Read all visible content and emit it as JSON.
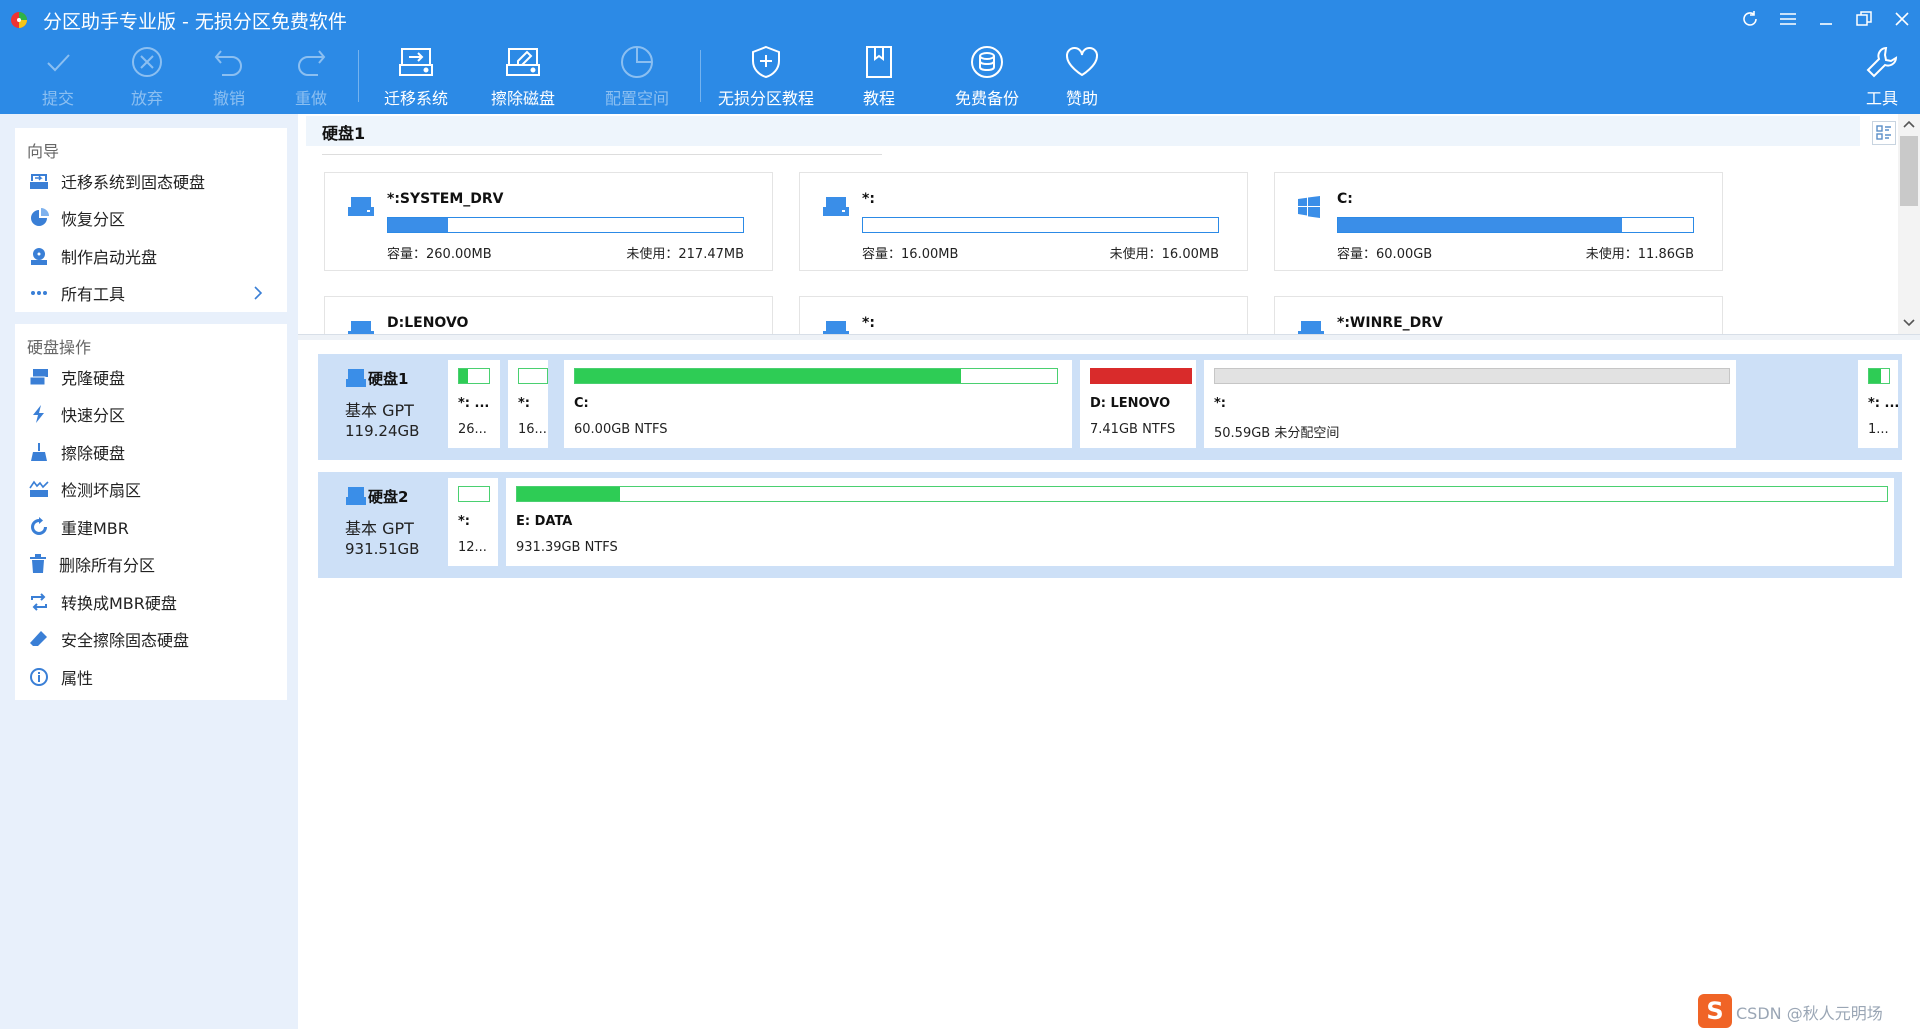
{
  "window": {
    "title": "分区助手专业版 - 无损分区免费软件"
  },
  "toolbar": {
    "commit": "提交",
    "discard": "放弃",
    "undo": "撤销",
    "redo": "重做",
    "migrate_os": "迁移系统",
    "wipe_disk": "擦除磁盘",
    "allocate_space": "配置空间",
    "tutorial_lossless": "无损分区教程",
    "tutorial": "教程",
    "free_backup": "免费备份",
    "donate": "赞助",
    "tools": "工具"
  },
  "sidebar": {
    "wizard_header": "向导",
    "wizard_items": [
      "迁移系统到固态硬盘",
      "恢复分区",
      "制作启动光盘",
      "所有工具"
    ],
    "disk_ops_header": "硬盘操作",
    "disk_ops_items": [
      "克隆硬盘",
      "快速分区",
      "擦除硬盘",
      "检测坏扇区",
      "重建MBR",
      "删除所有分区",
      "转换成MBR硬盘",
      "安全擦除固态硬盘",
      "属性"
    ]
  },
  "card_view": {
    "disk_tab": "硬盘1",
    "cap_label": "容量：",
    "free_label": "未使用：",
    "cards": [
      {
        "name": "*:SYSTEM_DRV",
        "capacity": "260.00MB",
        "free": "217.47MB",
        "used_fraction": 0.17,
        "icon": "drive-icon"
      },
      {
        "name": "*:",
        "capacity": "16.00MB",
        "free": "16.00MB",
        "used_fraction": 0.0,
        "icon": "drive-icon"
      },
      {
        "name": "C:",
        "capacity": "60.00GB",
        "free": "11.86GB",
        "used_fraction": 0.8,
        "icon": "windows-icon"
      },
      {
        "name": "D:LENOVO",
        "icon": "drive-icon"
      },
      {
        "name": "*:",
        "icon": "drive-icon"
      },
      {
        "name": "*:WINRE_DRV",
        "icon": "drive-icon"
      }
    ]
  },
  "disks": [
    {
      "name": "硬盘1",
      "type": "基本 GPT",
      "size": "119.24GB",
      "partitions": [
        {
          "label": "*: ...",
          "detail": "26...",
          "used_fraction": 0.3,
          "color": "#2ecc55"
        },
        {
          "label": "*:",
          "detail": "16...",
          "used_fraction": 0.0,
          "color": "#2ecc55"
        },
        {
          "label": "C:",
          "detail": "60.00GB NTFS",
          "used_fraction": 0.8,
          "color": "#2ecc55"
        },
        {
          "label": "D: LENOVO",
          "detail": "7.41GB NTFS",
          "used_fraction": 1.0,
          "color": "#d92b2b"
        },
        {
          "label": "*:",
          "detail": "50.59GB 未分配空间",
          "used_fraction": 1.0,
          "color": "#e2e2e2"
        },
        {
          "label": "*: ...",
          "detail": "1...",
          "used_fraction": 0.6,
          "color": "#2ecc55"
        }
      ]
    },
    {
      "name": "硬盘2",
      "type": "基本 GPT",
      "size": "931.51GB",
      "partitions": [
        {
          "label": "*:",
          "detail": "12...",
          "used_fraction": 0.0,
          "color": "#2ecc55"
        },
        {
          "label": "E: DATA",
          "detail": "931.39GB NTFS",
          "used_fraction": 0.075,
          "color": "#2ecc55"
        }
      ]
    }
  ],
  "watermark": {
    "text": "CSDN @秋人元明场",
    "logo_letter": "S"
  },
  "colors": {
    "accent": "#2c8ae6",
    "sidebar_bg": "#e8f0fb",
    "disk_row_bg": "#cde0f7",
    "used_green": "#2ecc55",
    "used_red": "#d92b2b",
    "card_bar": "#3a8ee8"
  }
}
